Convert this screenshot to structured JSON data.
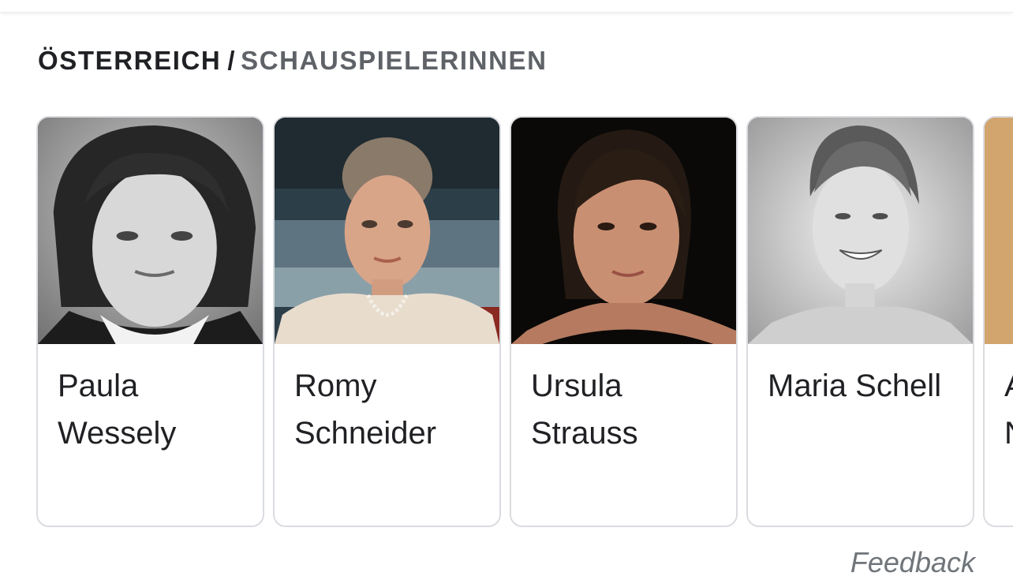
{
  "header": {
    "primary": "ÖSTERREICH",
    "separator": "/",
    "secondary": "SCHAUSPIELERINNEN"
  },
  "cards": [
    {
      "name_line1": "Paula",
      "name_line2": "Wessely"
    },
    {
      "name_line1": "Romy",
      "name_line2": "Schneider"
    },
    {
      "name_line1": "Ursula",
      "name_line2": "Strauss"
    },
    {
      "name_line1": "Maria Schell",
      "name_line2": ""
    },
    {
      "name_line1": "A",
      "name_line2": "N"
    }
  ],
  "footer": {
    "feedback": "Feedback"
  },
  "colors": {
    "heading_primary": "#202124",
    "heading_secondary": "#5f6368",
    "card_border": "#dadce0",
    "feedback": "#70757a"
  }
}
